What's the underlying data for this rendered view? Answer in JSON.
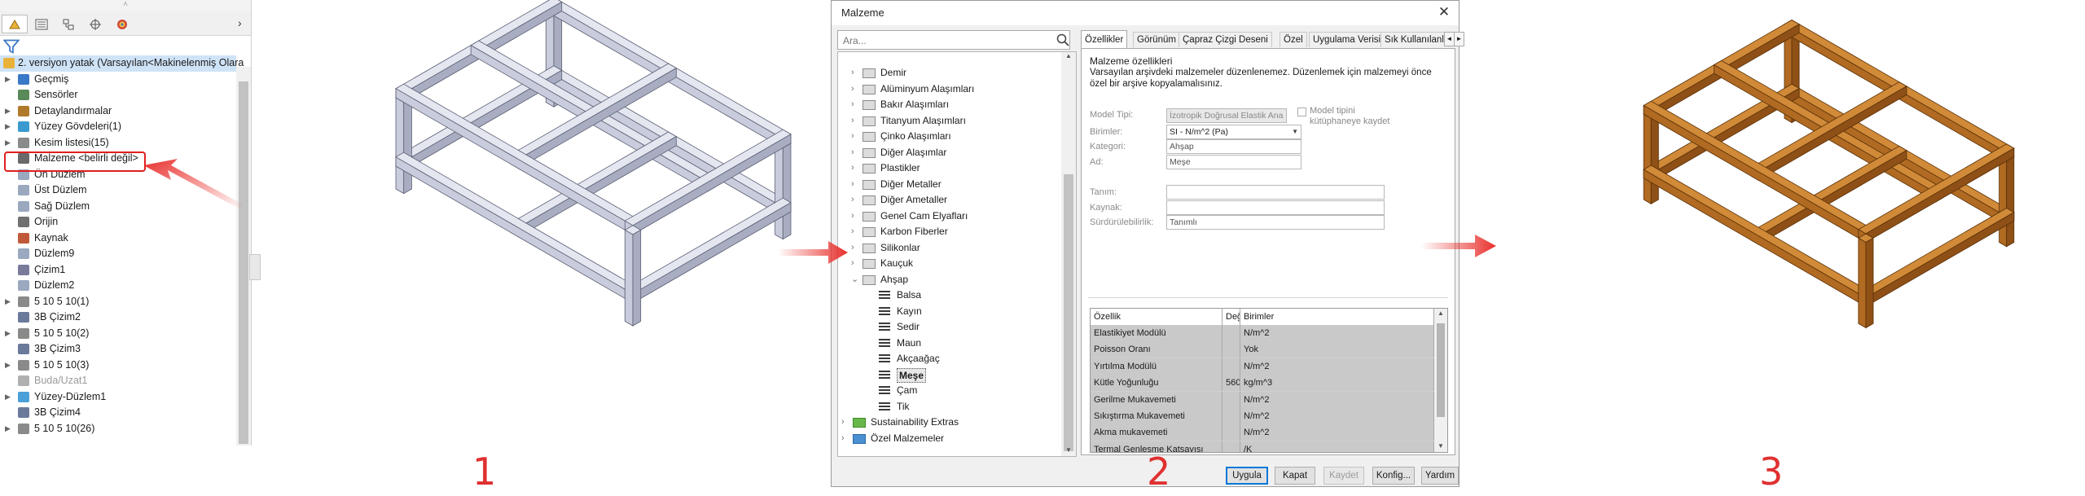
{
  "step_numbers": [
    "1",
    "2",
    "3"
  ],
  "feature_tree": {
    "grip": "˄",
    "collapse_glyph": "›",
    "tabs": [
      {
        "icon": "feature-manager-icon"
      },
      {
        "icon": "property-manager-icon"
      },
      {
        "icon": "configuration-manager-icon"
      },
      {
        "icon": "dimxpert-icon"
      },
      {
        "icon": "display-manager-icon"
      }
    ],
    "filter_icon": "filter-icon",
    "root_label": "2. versiyon yatak  (Varsayılan<Makinelenmiş Olara",
    "items": [
      {
        "label": "Geçmiş",
        "expandable": true,
        "icon": "history-icon"
      },
      {
        "label": "Sensörler",
        "expandable": false,
        "icon": "sensor-icon"
      },
      {
        "label": "Detaylandırmalar",
        "expandable": true,
        "icon": "annotations-icon"
      },
      {
        "label": "Yüzey Gövdeleri(1)",
        "expandable": true,
        "icon": "surface-bodies-icon"
      },
      {
        "label": "Kesim listesi(15)",
        "expandable": true,
        "icon": "cut-list-icon"
      },
      {
        "label": "Malzeme <belirli değil>",
        "expandable": false,
        "icon": "material-icon",
        "highlighted": true
      },
      {
        "label": "Ön Düzlem",
        "expandable": false,
        "icon": "plane-icon"
      },
      {
        "label": "Üst Düzlem",
        "expandable": false,
        "icon": "plane-icon"
      },
      {
        "label": "Sağ Düzlem",
        "expandable": false,
        "icon": "plane-icon"
      },
      {
        "label": "Orijin",
        "expandable": false,
        "icon": "origin-icon"
      },
      {
        "label": "Kaynak",
        "expandable": false,
        "icon": "weldment-icon"
      },
      {
        "label": "Düzlem9",
        "expandable": false,
        "icon": "plane-icon"
      },
      {
        "label": "Çizim1",
        "expandable": false,
        "icon": "sketch-icon"
      },
      {
        "label": "Düzlem2",
        "expandable": false,
        "icon": "plane-icon"
      },
      {
        "label": "5 10 5 10(1)",
        "expandable": true,
        "icon": "structural-member-icon"
      },
      {
        "label": "3B Çizim2",
        "expandable": false,
        "icon": "3d-sketch-icon"
      },
      {
        "label": "5 10 5 10(2)",
        "expandable": true,
        "icon": "structural-member-icon"
      },
      {
        "label": "3B Çizim3",
        "expandable": false,
        "icon": "3d-sketch-icon"
      },
      {
        "label": "5 10 5 10(3)",
        "expandable": true,
        "icon": "structural-member-icon"
      },
      {
        "label": "Buda/Uzat1",
        "expandable": false,
        "icon": "trim-extend-icon",
        "dimmed": true
      },
      {
        "label": "Yüzey-Düzlem1",
        "expandable": true,
        "icon": "surface-plane-icon"
      },
      {
        "label": "3B Çizim4",
        "expandable": false,
        "icon": "3d-sketch-icon"
      },
      {
        "label": "5 10 5 10(26)",
        "expandable": true,
        "icon": "structural-member-icon"
      }
    ]
  },
  "dialog": {
    "title": "Malzeme",
    "close_glyph": "✕",
    "search_placeholder": "Ara...",
    "search_icon": "search-icon",
    "library": [
      {
        "label": "Demir",
        "level": 1,
        "type": "folder",
        "expandable": true
      },
      {
        "label": "Alüminyum Alaşımları",
        "level": 1,
        "type": "folder",
        "expandable": true
      },
      {
        "label": "Bakır Alaşımları",
        "level": 1,
        "type": "folder",
        "expandable": true
      },
      {
        "label": "Titanyum Alaşımları",
        "level": 1,
        "type": "folder",
        "expandable": true
      },
      {
        "label": "Çinko Alaşımları",
        "level": 1,
        "type": "folder",
        "expandable": true
      },
      {
        "label": "Diğer Alaşımlar",
        "level": 1,
        "type": "folder",
        "expandable": true
      },
      {
        "label": "Plastikler",
        "level": 1,
        "type": "folder",
        "expandable": true
      },
      {
        "label": "Diğer Metaller",
        "level": 1,
        "type": "folder",
        "expandable": true
      },
      {
        "label": "Diğer Ametaller",
        "level": 1,
        "type": "folder",
        "expandable": true
      },
      {
        "label": "Genel Cam Elyafları",
        "level": 1,
        "type": "folder",
        "expandable": true
      },
      {
        "label": "Karbon Fiberler",
        "level": 1,
        "type": "folder",
        "expandable": true
      },
      {
        "label": "Silikonlar",
        "level": 1,
        "type": "folder",
        "expandable": true
      },
      {
        "label": "Kauçuk",
        "level": 1,
        "type": "folder",
        "expandable": true
      },
      {
        "label": "Ahşap",
        "level": 1,
        "type": "folder",
        "expandable": true,
        "expanded": true
      },
      {
        "label": "Balsa",
        "level": 2,
        "type": "material"
      },
      {
        "label": "Kayın",
        "level": 2,
        "type": "material"
      },
      {
        "label": "Sedir",
        "level": 2,
        "type": "material"
      },
      {
        "label": "Maun",
        "level": 2,
        "type": "material"
      },
      {
        "label": "Akçaağaç",
        "level": 2,
        "type": "material"
      },
      {
        "label": "Meşe",
        "level": 2,
        "type": "material",
        "selected": true
      },
      {
        "label": "Çam",
        "level": 2,
        "type": "material"
      },
      {
        "label": "Tik",
        "level": 2,
        "type": "material"
      },
      {
        "label": "Sustainability Extras",
        "level": 0,
        "type": "library-green",
        "expandable": true
      },
      {
        "label": "Özel Malzemeler",
        "level": 0,
        "type": "library-blue",
        "expandable": true
      }
    ],
    "tabs": [
      "Özellikler",
      "Görünüm",
      "Çapraz Çizgi Deseni",
      "Özel",
      "Uygulama Verisi",
      "Sık Kullanılanlar"
    ],
    "tab_arrows": [
      "◄",
      "►"
    ],
    "properties": {
      "heading": "Malzeme özellikleri",
      "description": "Varsayılan arşivdeki malzemeler düzenlenemez. Düzenlemek için malzemeyi önce özel bir arşive kopyalamalısınız.",
      "model_type_label": "Model Tipi:",
      "model_type_value": "İzotropik Doğrusal Elastik Ana",
      "save_to_lib_label": "Model tipini kütüphaneye kaydet",
      "units_label": "Birimler:",
      "units_value": "SI - N/m^2 (Pa)",
      "category_label": "Kategori:",
      "category_value": "Ahşap",
      "name_label": "Ad:",
      "name_value": "Meşe",
      "definition_label": "Tanım:",
      "definition_value": "",
      "source_label": "Kaynak:",
      "source_value": "",
      "sustainability_label": "Sürdürülebilirlik:",
      "sustainability_value": "Tanımlı"
    },
    "table": {
      "headers": [
        "Özellik",
        "Değer",
        "Birimler"
      ],
      "rows": [
        [
          "Elastikiyet Modülü",
          "",
          "N/m^2"
        ],
        [
          "Poisson Oranı",
          "",
          "Yok"
        ],
        [
          "Yırtılma Modülü",
          "",
          "N/m^2"
        ],
        [
          "Kütle Yoğunluğu",
          "560",
          "kg/m^3"
        ],
        [
          "Gerilme Mukavemeti",
          "",
          "N/m^2"
        ],
        [
          "Sıkıştırma Mukavemeti",
          "",
          "N/m^2"
        ],
        [
          "Akma mukavemeti",
          "",
          "N/m^2"
        ],
        [
          "Termal Genleşme Katsayısı",
          "",
          "/K"
        ]
      ]
    },
    "buttons": {
      "apply": "Uygula",
      "close": "Kapat",
      "save": "Kaydet",
      "config": "Konfig...",
      "help": "Yardım"
    }
  },
  "colors": {
    "arrow_red": "#e8302c",
    "frame_metal": "#d4d6e4",
    "frame_wood": "#c47a2a",
    "selection_blue": "#cfe3f7"
  }
}
